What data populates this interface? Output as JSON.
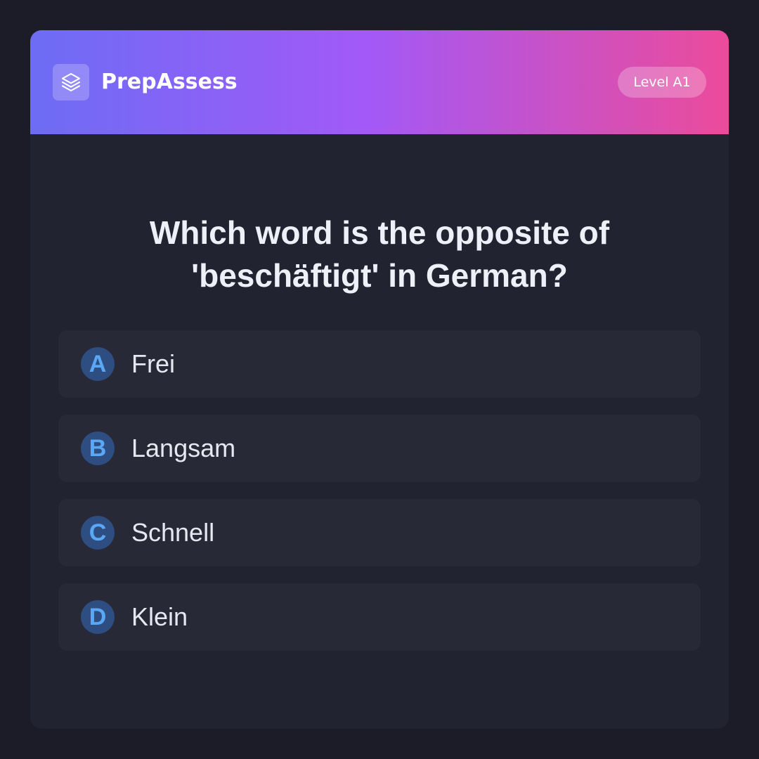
{
  "header": {
    "brand": "PrepAssess",
    "logo_icon": "layers-icon",
    "level_badge": "Level A1",
    "gradient_colors": [
      "#6d6cf5",
      "#a259f7",
      "#ec4b9a"
    ]
  },
  "question": {
    "text": "Which word is the opposite of 'beschäftigt' in German?"
  },
  "options": [
    {
      "letter": "A",
      "text": "Frei"
    },
    {
      "letter": "B",
      "text": "Langsam"
    },
    {
      "letter": "C",
      "text": "Schnell"
    },
    {
      "letter": "D",
      "text": "Klein"
    }
  ],
  "colors": {
    "page_background": "#1b1c27",
    "card_background": "#212330",
    "option_background": "#272937",
    "letter_circle": "#2e4d80",
    "letter_text": "#5aa8f5"
  }
}
